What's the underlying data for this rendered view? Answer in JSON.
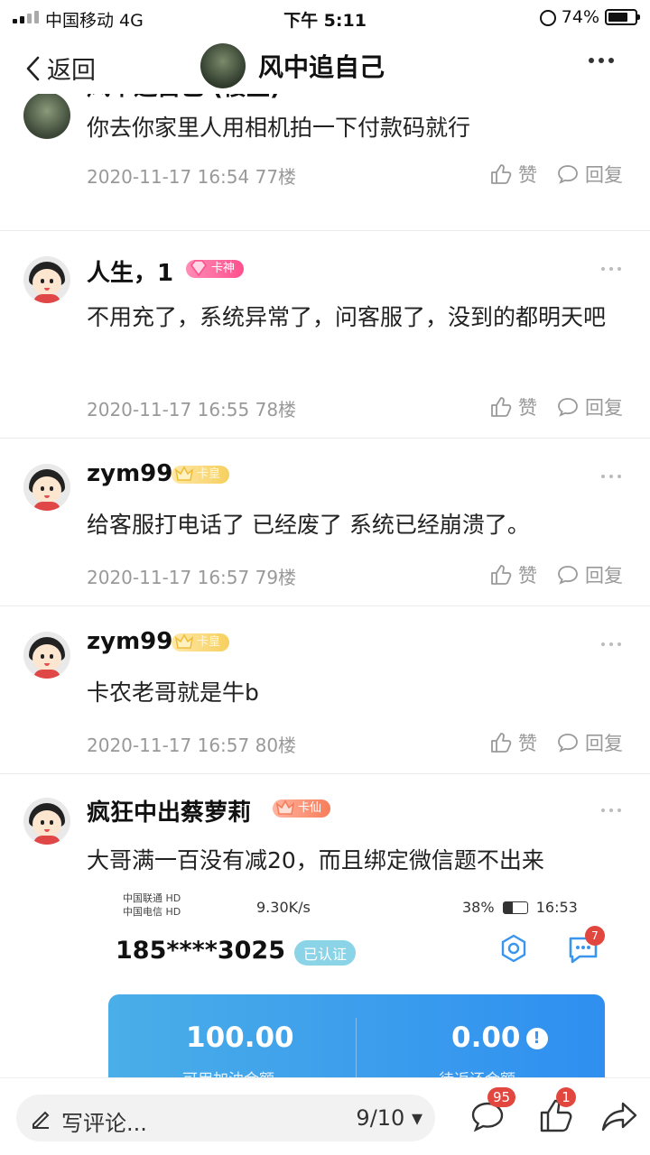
{
  "status_bar": {
    "carrier": "中国移动   4G",
    "time": "下午 5:11",
    "battery": "74%"
  },
  "nav": {
    "back_label": "返回",
    "title": "风中追自己"
  },
  "posts": [
    {
      "username": "风中追自己 (楼主)",
      "content": "你去你家里人用相机拍一下付款码就行",
      "date": "2020-11-17 16:54",
      "floor": "77楼",
      "like": "赞",
      "reply": "回复"
    },
    {
      "username": "人生，1",
      "badge": "卡神",
      "content": "不用充了，系统异常了，问客服了，没到的都明天吧",
      "date": "2020-11-17 16:55",
      "floor": "78楼",
      "like": "赞",
      "reply": "回复"
    },
    {
      "username": "zym99",
      "badge": "卡皇",
      "content": "给客服打电话了 已经废了 系统已经崩溃了。",
      "date": "2020-11-17 16:57",
      "floor": "79楼",
      "like": "赞",
      "reply": "回复"
    },
    {
      "username": "zym99",
      "badge": "卡皇",
      "content": "卡农老哥就是牛b",
      "date": "2020-11-17 16:57",
      "floor": "80楼",
      "like": "赞",
      "reply": "回复"
    },
    {
      "username": "疯狂中出蔡萝莉",
      "badge": "卡仙",
      "content": "大哥满一百没有减20，而且绑定微信题不出来"
    }
  ],
  "embedded_screenshot": {
    "carrier1": "中国联通 HD",
    "carrier2": "中国电信 HD",
    "speed": "9.30K/s",
    "battery": "38%",
    "time": "16:53",
    "phone": "185****3025",
    "verified": "已认证",
    "msg_count": "7",
    "available_amount": "100.00",
    "available_label": "可用加油金额",
    "pending_amount": "0.00",
    "pending_label": "待返还金额",
    "info_glyph": "!"
  },
  "bottom_bar": {
    "placeholder": "写评论...",
    "page_indicator": "9/10 ▾",
    "comments_count": "95",
    "likes_count": "1"
  },
  "colors": {
    "badge_pink": "#ff4f8d",
    "badge_gold": "#f6cf5e",
    "badge_orange": "#f77d5a",
    "card_blue": "#2f8ff0",
    "notification_red": "#e2473f"
  }
}
